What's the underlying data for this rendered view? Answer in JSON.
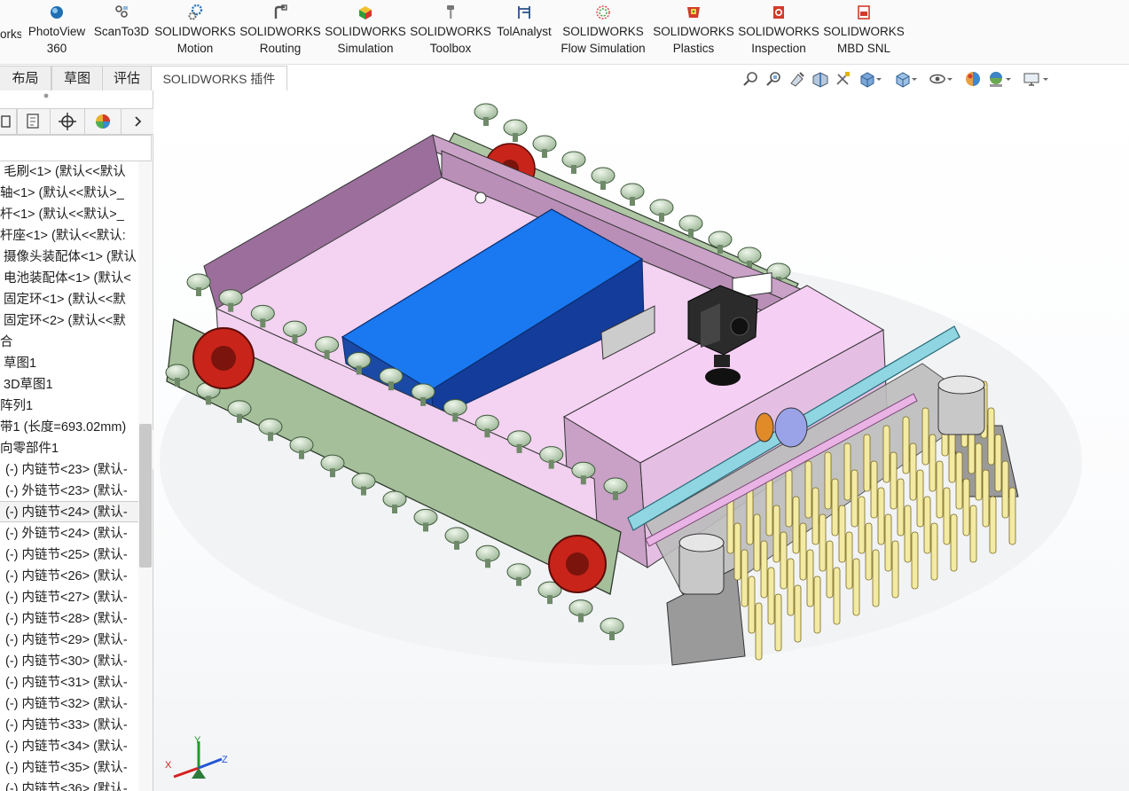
{
  "ribbon": {
    "items": [
      {
        "label": "orks",
        "icon": "solidworks-cut-icon"
      },
      {
        "label": "PhotoView 360",
        "line1": "PhotoView",
        "line2": "360",
        "icon": "photoview-sphere-icon"
      },
      {
        "label": "ScanTo3D",
        "icon": "scanto3d-icon"
      },
      {
        "line1": "SOLIDWORKS",
        "line2": "Motion",
        "icon": "motion-gears-icon"
      },
      {
        "line1": "SOLIDWORKS",
        "line2": "Routing",
        "icon": "routing-icon"
      },
      {
        "line1": "SOLIDWORKS",
        "line2": "Simulation",
        "icon": "simulation-cube-icon"
      },
      {
        "line1": "SOLIDWORKS",
        "line2": "Toolbox",
        "icon": "toolbox-screw-icon"
      },
      {
        "label": "TolAnalyst",
        "icon": "tolanalyst-icon"
      },
      {
        "line1": "SOLIDWORKS",
        "line2": "Flow Simulation",
        "icon": "flow-simulation-icon"
      },
      {
        "line1": "SOLIDWORKS",
        "line2": "Plastics",
        "icon": "plastics-icon"
      },
      {
        "line1": "SOLIDWORKS",
        "line2": "Inspection",
        "icon": "inspection-icon"
      },
      {
        "line1": "SOLIDWORKS",
        "line2": "MBD SNL",
        "icon": "mbd-snl-icon"
      }
    ]
  },
  "tabs": [
    {
      "label": "布局"
    },
    {
      "label": "草图"
    },
    {
      "label": "评估"
    },
    {
      "label": "SOLIDWORKS 插件"
    }
  ],
  "hud_icons": [
    "zoom-to-fit-icon",
    "zoom-to-area-icon",
    "previous-view-icon",
    "section-view-icon",
    "dynamic-annotation-icon",
    "view-orientation-icon",
    "display-style-icon",
    "hide-show-icon",
    "edit-appearance-icon",
    "apply-scene-icon",
    "view-settings-icon"
  ],
  "panel_tools": [
    "feature-manager-icon",
    "property-manager-icon",
    "configuration-manager-icon",
    "dimxpert-icon",
    "display-manager-icon"
  ],
  "tree": {
    "rows": [
      {
        "text": "毛刷<1> (默认<<默认"
      },
      {
        "text": "轴<1> (默认<<默认>_"
      },
      {
        "text": "杆<1> (默认<<默认>_"
      },
      {
        "text": "杆座<1> (默认<<默认:"
      },
      {
        "text": "摄像头装配体<1> (默认"
      },
      {
        "text": "电池装配体<1> (默认<"
      },
      {
        "text": "固定环<1> (默认<<默"
      },
      {
        "text": "固定环<2> (默认<<默"
      },
      {
        "text": "合"
      },
      {
        "text": "草图1"
      },
      {
        "text": "3D草图1"
      },
      {
        "text": "阵列1"
      },
      {
        "text": "带1 (长度=693.02mm)"
      },
      {
        "text": "向零部件1"
      },
      {
        "text": "(-) 内链节<23> (默认-"
      },
      {
        "text": "(-) 外链节<23> (默认-"
      },
      {
        "text": "(-) 内链节<24> (默认-"
      },
      {
        "text": "(-) 外链节<24> (默认-"
      },
      {
        "text": "(-) 内链节<25> (默认-"
      },
      {
        "text": "(-) 内链节<26> (默认-"
      },
      {
        "text": "(-) 内链节<27> (默认-"
      },
      {
        "text": "(-) 内链节<28> (默认-"
      },
      {
        "text": "(-) 内链节<29> (默认-"
      },
      {
        "text": "(-) 内链节<30> (默认-"
      },
      {
        "text": "(-) 内链节<31> (默认-"
      },
      {
        "text": "(-) 内链节<32> (默认-"
      },
      {
        "text": "(-) 内链节<33> (默认-"
      },
      {
        "text": "(-) 内链节<34> (默认-"
      },
      {
        "text": "(-) 内链节<35> (默认-"
      },
      {
        "text": "(-) 内链节<36> (默认-"
      }
    ]
  },
  "triad": {
    "x": "X",
    "y": "Y",
    "z": "Z"
  },
  "colors": {
    "box_pink": "#e8c8e8",
    "battery_blue": "#1a6de0",
    "chain_green": "#a8c3a0",
    "sprocket_red": "#c8241a",
    "brush_yellow": "#f3eaa3",
    "shaft_cyan": "#8fd6e2"
  }
}
